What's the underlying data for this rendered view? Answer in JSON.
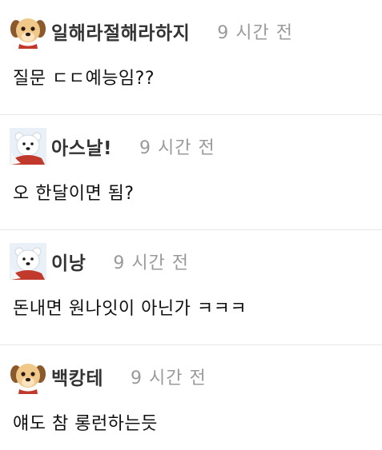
{
  "comments": [
    {
      "author": "일해라절해라하지",
      "time": "9 시간 전",
      "text": "질문 ㄷㄷ예능임??",
      "avatar": "puppy-avatar-icon"
    },
    {
      "author": "아스날!",
      "time": "9 시간 전",
      "text": "오 한달이면 됨?",
      "avatar": "polar-bear-avatar-icon"
    },
    {
      "author": "이낭",
      "time": "9 시간 전",
      "text": "돈내면 원나잇이 아닌가 ㅋㅋㅋ",
      "avatar": "polar-bear-avatar-icon"
    },
    {
      "author": "백캉테",
      "time": "9 시간 전",
      "text": "얘도 참 롱런하는듯",
      "avatar": "puppy-avatar-icon"
    }
  ],
  "colors": {
    "author": "#333333",
    "time": "#9a9a9a",
    "text": "#111111",
    "divider": "#e6e6e6"
  }
}
